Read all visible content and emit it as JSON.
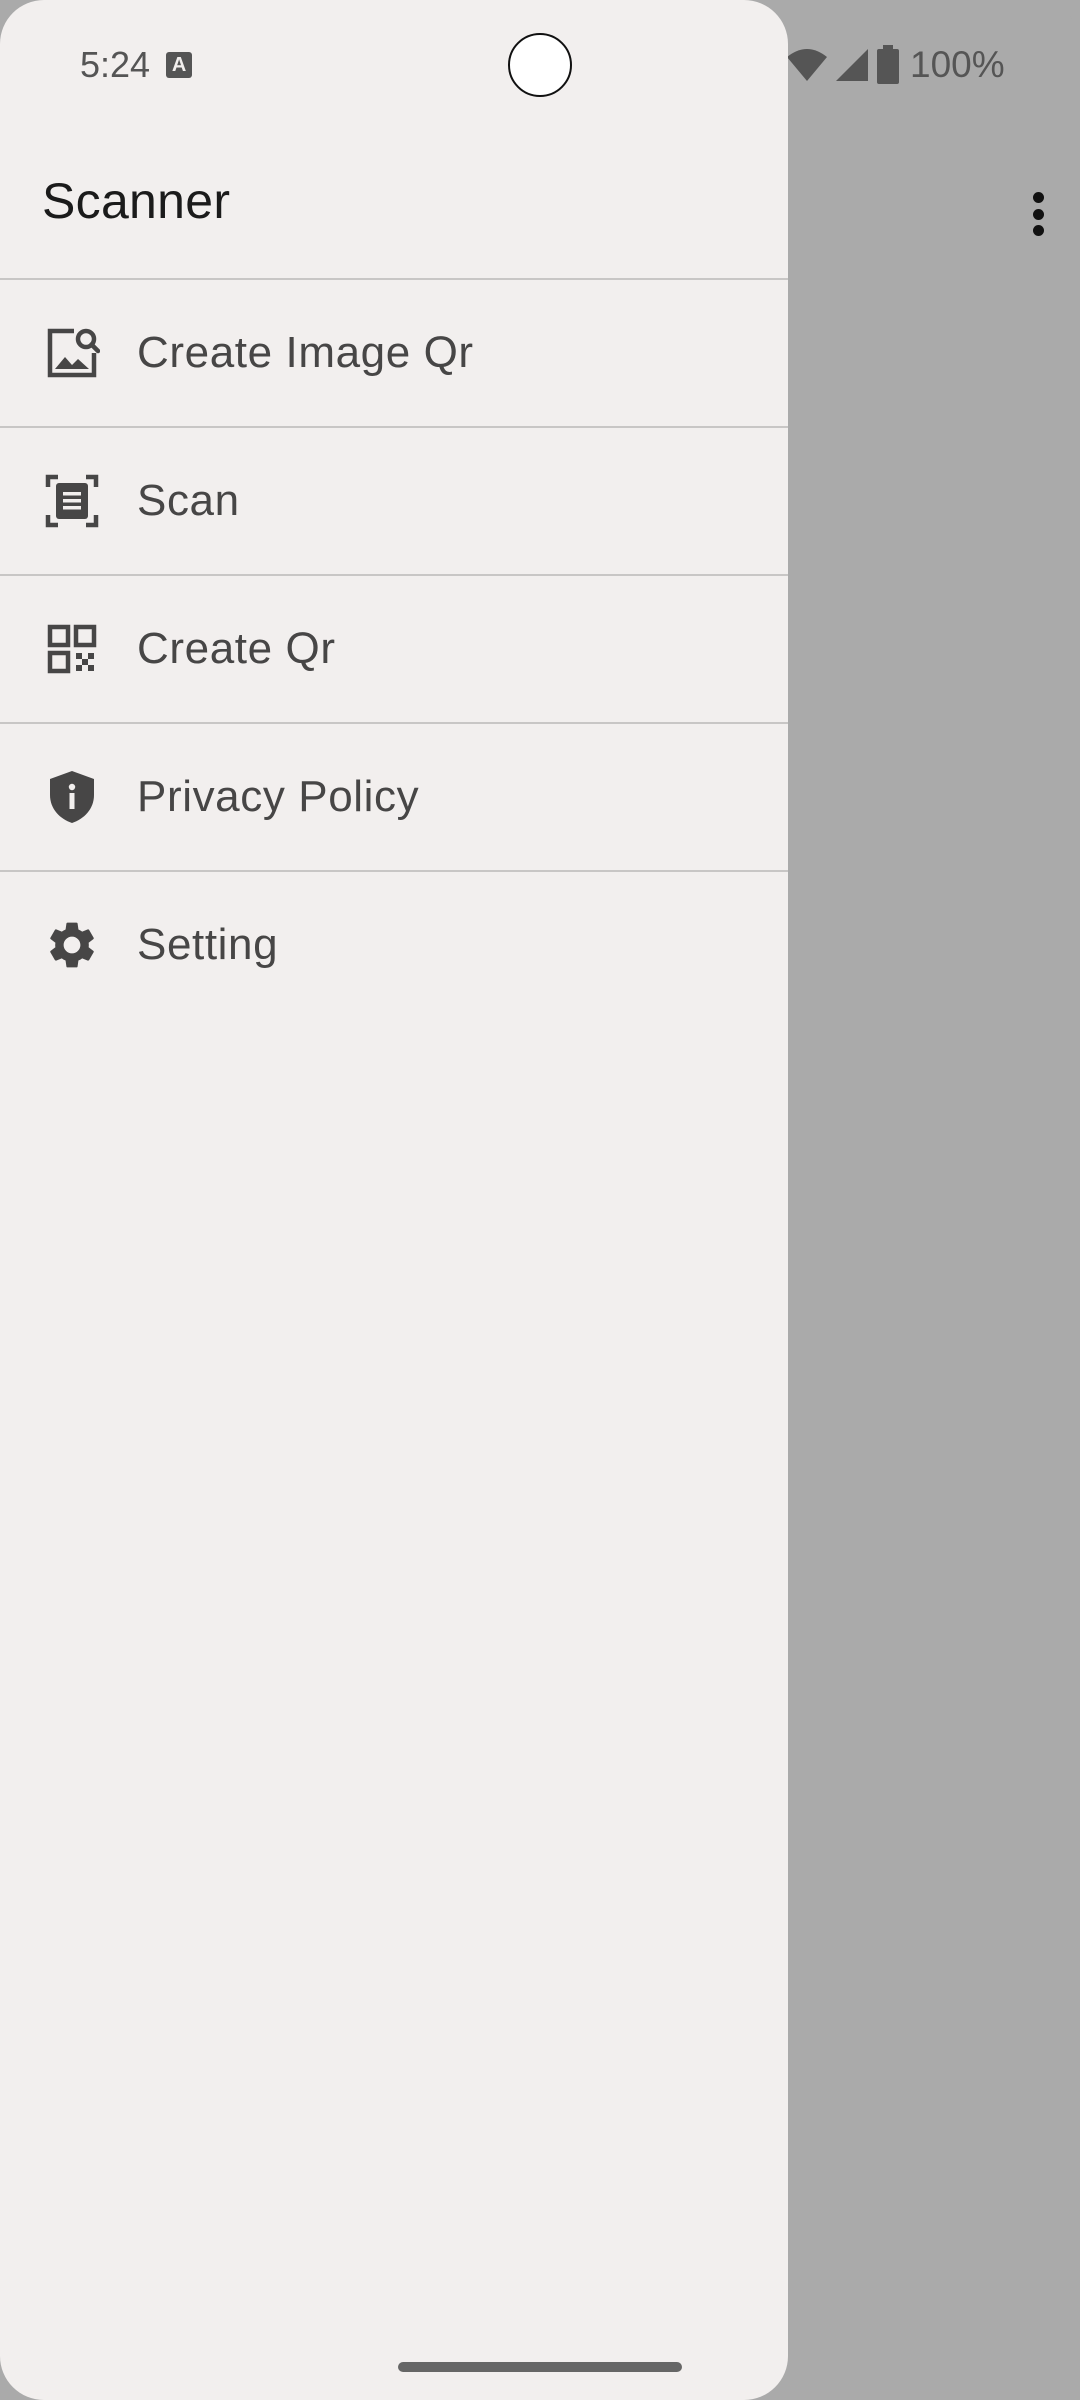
{
  "status_bar": {
    "time": "5:24",
    "keyboard_badge": "A",
    "battery_level": "100%"
  },
  "drawer": {
    "title": "Scanner",
    "items": [
      {
        "label": "Create Image Qr",
        "icon": "image-search-icon"
      },
      {
        "label": "Scan",
        "icon": "document-scan-icon"
      },
      {
        "label": "Create Qr",
        "icon": "qr-code-icon"
      },
      {
        "label": "Privacy Policy",
        "icon": "shield-info-icon"
      },
      {
        "label": "Setting",
        "icon": "gear-icon"
      }
    ]
  },
  "app_bar": {
    "overflow_icon": "more-vert-icon"
  },
  "colors": {
    "drawer_background": "#f2efee",
    "scrim": "#aaaaaa",
    "text_primary": "#1b1b1b",
    "text_secondary": "#474646"
  }
}
